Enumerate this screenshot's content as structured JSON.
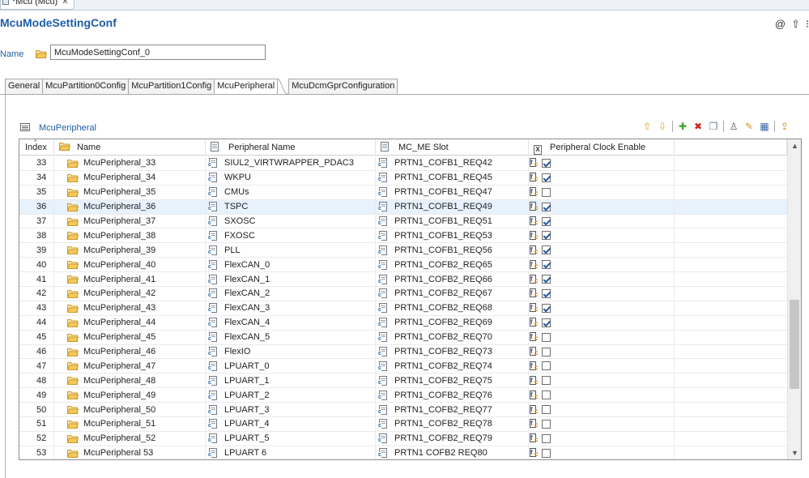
{
  "editor_tab": {
    "label": "*Mcu (Mcu)",
    "close": "✕"
  },
  "title": "McuModeSettingConf",
  "header_tools": {
    "at": "@",
    "up": "⇧"
  },
  "name_field": {
    "label": "Name",
    "value": "McuModeSettingConf_0"
  },
  "tabs": [
    "General",
    "McuPartition0Config",
    "McuPartition1Config",
    "McuPeripheral",
    "McuDcmGprConfiguration"
  ],
  "active_tab": "McuPeripheral",
  "section": {
    "title": "McuPeripheral",
    "tools": [
      "move-up-icon",
      "move-down-icon",
      "add-icon",
      "delete-icon",
      "copy-icon",
      "person-icon",
      "edit-icon",
      "table-edit-icon",
      "export-icon"
    ]
  },
  "columns": {
    "index": "Index",
    "name": "Name",
    "peripheral": "Peripheral Name",
    "slot": "MC_ME Slot",
    "clock": "Peripheral Clock Enable"
  },
  "rows": [
    {
      "index": "33",
      "name": "McuPeripheral_33",
      "peripheral": "SIUL2_VIRTWRAPPER_PDAC3",
      "slot": "PRTN1_COFB1_REQ42",
      "clock": true,
      "fx": "blue"
    },
    {
      "index": "34",
      "name": "McuPeripheral_34",
      "peripheral": "WKPU",
      "slot": "PRTN1_COFB1_REQ45",
      "clock": true,
      "fx": "blue"
    },
    {
      "index": "35",
      "name": "McuPeripheral_35",
      "peripheral": "CMUs",
      "slot": "PRTN1_COFB1_REQ47",
      "clock": false,
      "fx": "blue"
    },
    {
      "index": "36",
      "name": "McuPeripheral_36",
      "peripheral": "TSPC",
      "slot": "PRTN1_COFB1_REQ49",
      "clock": true,
      "fx": "blue",
      "selected": true
    },
    {
      "index": "37",
      "name": "McuPeripheral_37",
      "peripheral": "SXOSC",
      "slot": "PRTN1_COFB1_REQ51",
      "clock": true,
      "fx": "blue"
    },
    {
      "index": "38",
      "name": "McuPeripheral_38",
      "peripheral": "FXOSC",
      "slot": "PRTN1_COFB1_REQ53",
      "clock": true,
      "fx": "blue"
    },
    {
      "index": "39",
      "name": "McuPeripheral_39",
      "peripheral": "PLL",
      "slot": "PRTN1_COFB1_REQ56",
      "clock": true,
      "fx": "blue"
    },
    {
      "index": "40",
      "name": "McuPeripheral_40",
      "peripheral": "FlexCAN_0",
      "slot": "PRTN1_COFB2_REQ65",
      "clock": true,
      "fx": "purple"
    },
    {
      "index": "41",
      "name": "McuPeripheral_41",
      "peripheral": "FlexCAN_1",
      "slot": "PRTN1_COFB2_REQ66",
      "clock": true,
      "fx": "purple"
    },
    {
      "index": "42",
      "name": "McuPeripheral_42",
      "peripheral": "FlexCAN_2",
      "slot": "PRTN1_COFB2_REQ67",
      "clock": true,
      "fx": "purple"
    },
    {
      "index": "43",
      "name": "McuPeripheral_43",
      "peripheral": "FlexCAN_3",
      "slot": "PRTN1_COFB2_REQ68",
      "clock": true,
      "fx": "purple"
    },
    {
      "index": "44",
      "name": "McuPeripheral_44",
      "peripheral": "FlexCAN_4",
      "slot": "PRTN1_COFB2_REQ69",
      "clock": true,
      "fx": "purple"
    },
    {
      "index": "45",
      "name": "McuPeripheral_45",
      "peripheral": "FlexCAN_5",
      "slot": "PRTN1_COFB2_REQ70",
      "clock": false,
      "fx": "blue"
    },
    {
      "index": "46",
      "name": "McuPeripheral_46",
      "peripheral": "FlexIO",
      "slot": "PRTN1_COFB2_REQ73",
      "clock": false,
      "fx": "blue"
    },
    {
      "index": "47",
      "name": "McuPeripheral_47",
      "peripheral": "LPUART_0",
      "slot": "PRTN1_COFB2_REQ74",
      "clock": false,
      "fx": "blue"
    },
    {
      "index": "48",
      "name": "McuPeripheral_48",
      "peripheral": "LPUART_1",
      "slot": "PRTN1_COFB2_REQ75",
      "clock": false,
      "fx": "blue"
    },
    {
      "index": "49",
      "name": "McuPeripheral_49",
      "peripheral": "LPUART_2",
      "slot": "PRTN1_COFB2_REQ76",
      "clock": false,
      "fx": "blue"
    },
    {
      "index": "50",
      "name": "McuPeripheral_50",
      "peripheral": "LPUART_3",
      "slot": "PRTN1_COFB2_REQ77",
      "clock": false,
      "fx": "blue"
    },
    {
      "index": "51",
      "name": "McuPeripheral_51",
      "peripheral": "LPUART_4",
      "slot": "PRTN1_COFB2_REQ78",
      "clock": false,
      "fx": "blue"
    },
    {
      "index": "52",
      "name": "McuPeripheral_52",
      "peripheral": "LPUART_5",
      "slot": "PRTN1_COFB2_REQ79",
      "clock": false,
      "fx": "blue"
    },
    {
      "index": "53",
      "name": "McuPeripheral 53",
      "peripheral": "LPUART 6",
      "slot": "PRTN1 COFB2 REQ80",
      "clock": false,
      "fx": "blue"
    }
  ],
  "scrollbar": {
    "up": "▲",
    "down": "▼"
  },
  "colors": {
    "accent": "#1d5fa7",
    "selected_row": "#e8f2fd"
  }
}
